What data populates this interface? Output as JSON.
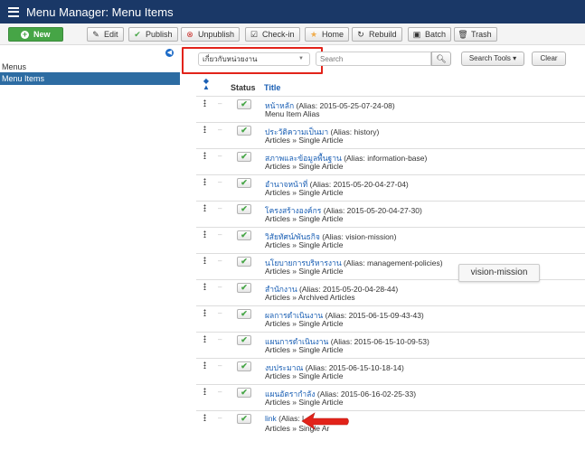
{
  "header": {
    "title": "Menu Manager: Menu Items"
  },
  "toolbar": {
    "new": "New",
    "edit": "Edit",
    "publish": "Publish",
    "unpublish": "Unpublish",
    "checkin": "Check-in",
    "home": "Home",
    "rebuild": "Rebuild",
    "batch": "Batch",
    "trash": "Trash"
  },
  "sidebar": {
    "items": [
      {
        "label": "Menus"
      },
      {
        "label": "Menu Items"
      }
    ]
  },
  "filters": {
    "menu_select": "เกี่ยวกับหน่วยงาน",
    "search_placeholder": "Search",
    "search_tools": "Search Tools ▾",
    "clear": "Clear"
  },
  "table": {
    "status_header": "Status",
    "title_header": "Title"
  },
  "rows": [
    {
      "title": "หน้าหลัก",
      "alias": "(Alias: 2015-05-25-07-24-08)",
      "type": "Menu Item Alias"
    },
    {
      "title": "ประวัติความเป็นมา",
      "alias": "(Alias: history)",
      "type": "Articles » Single Article"
    },
    {
      "title": "สภาพและข้อมูลพื้นฐาน",
      "alias": "(Alias: information-base)",
      "type": "Articles » Single Article"
    },
    {
      "title": "อำนาจหน้าที่",
      "alias": "(Alias: 2015-05-20-04-27-04)",
      "type": "Articles » Single Article"
    },
    {
      "title": "โครงสร้างองค์กร",
      "alias": "(Alias: 2015-05-20-04-27-30)",
      "type": "Articles » Single Article"
    },
    {
      "title": "วิสัยทัศน์/พันธกิจ",
      "alias": "(Alias: vision-mission)",
      "type": "Articles » Single Article"
    },
    {
      "title": "นโยบายการบริหารงาน",
      "alias": "(Alias: management-policies)",
      "type": "Articles » Single Article"
    },
    {
      "title": "สำนักงาน",
      "alias": "(Alias: 2015-05-20-04-28-44)",
      "type": "Articles » Archived Articles"
    },
    {
      "title": "ผลการดำเนินงาน",
      "alias": "(Alias: 2015-06-15-09-43-43)",
      "type": "Articles » Single Article"
    },
    {
      "title": "แผนการดำเนินงาน",
      "alias": "(Alias: 2015-06-15-10-09-53)",
      "type": "Articles » Single Article"
    },
    {
      "title": "งบประมาณ",
      "alias": "(Alias: 2015-06-15-10-18-14)",
      "type": "Articles » Single Article"
    },
    {
      "title": "แผนอัตรากำลัง",
      "alias": "(Alias: 2015-06-16-02-25-33)",
      "type": "Articles » Single Article"
    },
    {
      "title": "link",
      "alias": "(Alias: l",
      "type": "Articles » Single Ar"
    }
  ],
  "tooltip": {
    "text": "vision-mission"
  },
  "colors": {
    "header_bg": "#1a3867",
    "new_button": "#46a546",
    "highlight_box": "#e2231a",
    "arrow": "#e2231a",
    "link": "#1a5fb4"
  }
}
